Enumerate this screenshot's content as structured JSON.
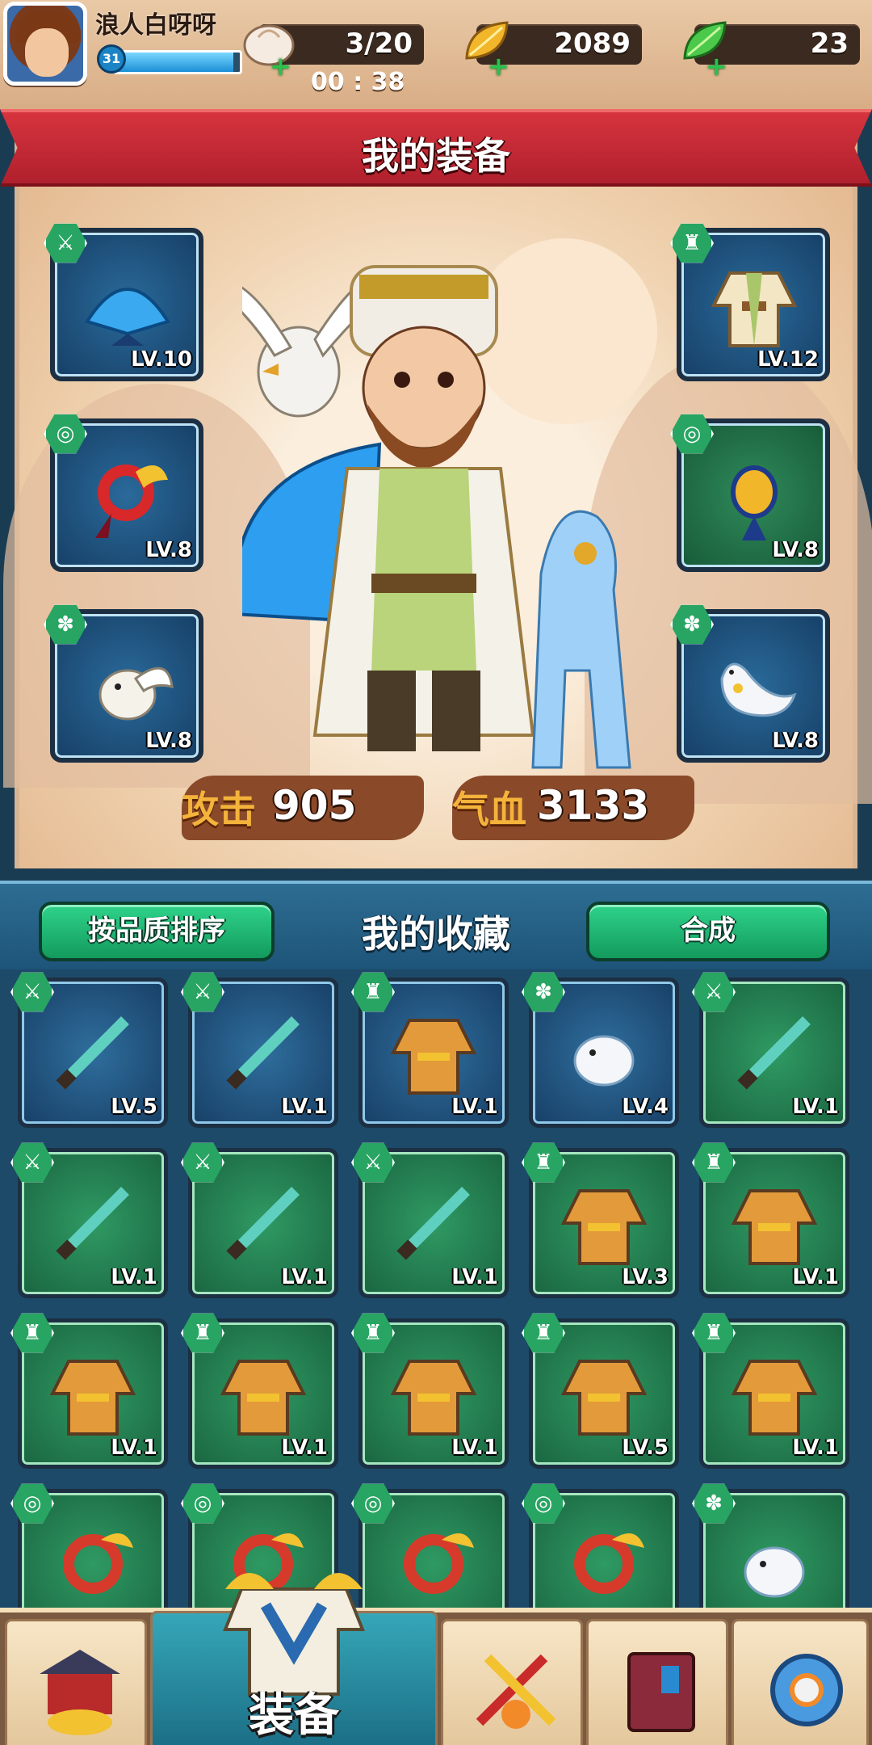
{
  "player": {
    "name": "浪人白呀呀",
    "level": "31",
    "xp_fraction": 0.95
  },
  "resources": {
    "energy": "3/20",
    "energy_timer": "00 : 38",
    "gold": "2089",
    "gems": "23"
  },
  "equip_panel": {
    "title": "我的装备",
    "left_slots": [
      {
        "name": "blue-fan",
        "level": "LV.10",
        "color": "blue",
        "category": "weapon"
      },
      {
        "name": "red-jade-pendant",
        "level": "LV.8",
        "color": "blue",
        "category": "accessory"
      },
      {
        "name": "white-bird-pet",
        "level": "LV.8",
        "color": "blue",
        "category": "pet"
      }
    ],
    "right_slots": [
      {
        "name": "green-robe",
        "level": "LV.12",
        "color": "blue",
        "category": "armor"
      },
      {
        "name": "blue-gold-pendant",
        "level": "LV.8",
        "color": "green",
        "category": "accessory"
      },
      {
        "name": "white-ferret-pet",
        "level": "LV.8",
        "color": "blue",
        "category": "pet"
      }
    ],
    "stats": {
      "attack_label": "攻击",
      "attack_value": "905",
      "hp_label": "气血",
      "hp_value": "3133"
    }
  },
  "collection": {
    "title": "我的收藏",
    "sort_button": "按品质排序",
    "combine_button": "合成",
    "items": [
      {
        "name": "green-sword",
        "level": "LV.5",
        "color": "blue",
        "category": "weapon"
      },
      {
        "name": "steel-dagger",
        "level": "LV.1",
        "color": "blue",
        "category": "weapon"
      },
      {
        "name": "green-robe",
        "level": "LV.1",
        "color": "blue",
        "category": "armor"
      },
      {
        "name": "monkey-pet",
        "level": "LV.4",
        "color": "blue",
        "category": "pet"
      },
      {
        "name": "blue-sword",
        "level": "LV.1",
        "color": "green",
        "category": "weapon"
      },
      {
        "name": "pink-fan",
        "level": "LV.1",
        "color": "green",
        "category": "weapon"
      },
      {
        "name": "pink-fan",
        "level": "LV.1",
        "color": "green",
        "category": "weapon"
      },
      {
        "name": "crossbow",
        "level": "LV.1",
        "color": "green",
        "category": "weapon"
      },
      {
        "name": "orange-armor",
        "level": "LV.3",
        "color": "green",
        "category": "armor"
      },
      {
        "name": "orange-armor",
        "level": "LV.1",
        "color": "green",
        "category": "armor"
      },
      {
        "name": "blue-fur-armor",
        "level": "LV.1",
        "color": "green",
        "category": "armor"
      },
      {
        "name": "blue-fur-armor",
        "level": "LV.1",
        "color": "green",
        "category": "armor"
      },
      {
        "name": "gold-plate-armor",
        "level": "LV.1",
        "color": "green",
        "category": "armor"
      },
      {
        "name": "gold-plate-armor",
        "level": "LV.5",
        "color": "green",
        "category": "armor"
      },
      {
        "name": "green-robe",
        "level": "LV.1",
        "color": "green",
        "category": "armor"
      },
      {
        "name": "green-jade-pendant",
        "level": "",
        "color": "green",
        "category": "accessory"
      },
      {
        "name": "blue-jade-pendant",
        "level": "",
        "color": "green",
        "category": "accessory"
      },
      {
        "name": "red-jade-pendant",
        "level": "",
        "color": "green",
        "category": "accessory"
      },
      {
        "name": "blue-gold-pendant",
        "level": "",
        "color": "green",
        "category": "accessory"
      },
      {
        "name": "white-ferret-pet",
        "level": "",
        "color": "green",
        "category": "pet"
      }
    ]
  },
  "bottom_nav": {
    "active_label": "装备",
    "items": [
      "shop-icon",
      "equipment-icon",
      "battle-icon",
      "book-icon",
      "settings-icon"
    ]
  },
  "colors": {
    "banner_red": "#c42a35",
    "button_green": "#22b572",
    "slot_blue": "#1f5a8a",
    "slot_green": "#23784a"
  }
}
